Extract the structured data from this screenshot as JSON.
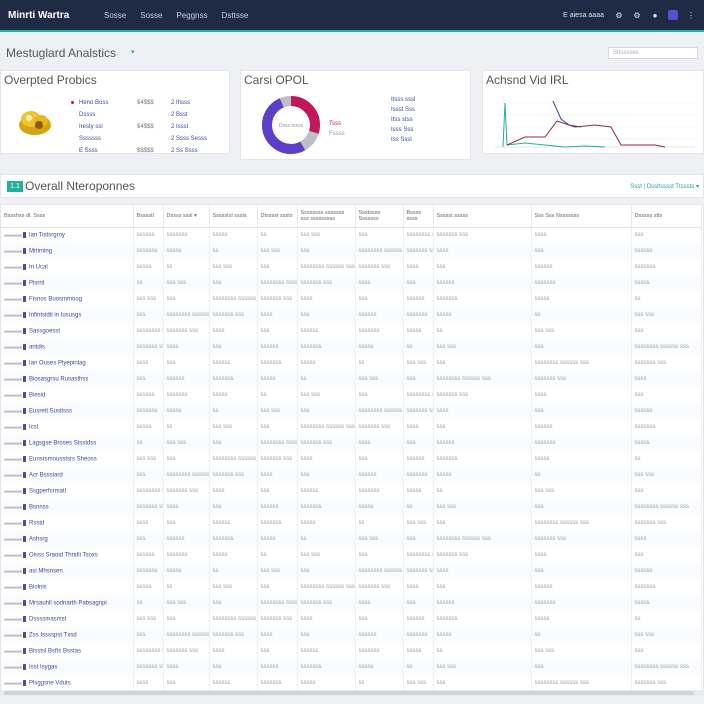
{
  "app": {
    "brand": "Minrti Wartra",
    "nav": [
      "Sosse",
      "Sosse",
      "Peggnss",
      "Dsttsse"
    ],
    "user": "E  aiesa aaaa"
  },
  "page": {
    "title": "Mestuglard Analstics",
    "search_placeholder": "Sttsssses"
  },
  "cards": {
    "products": {
      "title": "Overpted Probics",
      "col1": [
        "Heno Boss",
        "Dssss",
        "Iresty ssl",
        "Sssssss",
        "E Ssss"
      ],
      "col2": [
        "$4$$$",
        "",
        "$4$$$",
        "",
        "$$$$$"
      ],
      "col3": [
        "2 Ihsss",
        "2 Bsst",
        "2 Isssl",
        "2 Ssss Sesss",
        "2 Ss Ssss"
      ]
    },
    "cost": {
      "title": "Carsi OPOL",
      "center_label": "Dsss tnsss",
      "legend_a": [
        "Itsss sssl",
        "Issst Sss",
        "Itss stss",
        "Isss Sss",
        "Iss Sssl"
      ],
      "legend_b": [
        "",
        "",
        "",
        "Tsss",
        "Fssss"
      ],
      "colors": [
        "#c2185b",
        "#5b3fc7",
        "#bfbfc4"
      ]
    },
    "trend": {
      "title": "Achsnd Vid IRL"
    }
  },
  "section": {
    "badge": "1.1",
    "title": "Overall Nteroponnes",
    "links": "Ssst  |  Dssltsssst  Ttsssts  ▾"
  },
  "table": {
    "headers": [
      "Bssshss   dl. Ssss",
      "Bsssstl",
      "Dssss sssl ▾",
      "Ssssstsl sssts",
      "Dtsssst sssts",
      "Ssssssss sssssss sss sssssssss",
      "Ssstssss Sssssss",
      "Bssss ssss",
      "Ssssst sssss",
      "Sss Sss Nsssssss",
      "Dsssss stts",
      "Ssssssst sssssss"
    ],
    "rows": [
      "Ian Toitsrgroy",
      "Mrtiming",
      "Iri Ucal",
      "Pisrrit",
      "Fisnos Buosmmoog",
      "Infintsidti in Iususgs",
      "Sassgoesst",
      "antdis",
      "Ian Ouses Plyepinlag",
      "Biosasgrsu Rusasthss",
      "Biesid",
      "Eusrett Susitsss",
      "Icsl",
      "Lagsgse Broses Stsstdss",
      "Eunsrsmousstsrs Sheoss",
      "Acr Bsssiard",
      "Ssgperfsrmatl",
      "Bsnnss",
      "Rsstd",
      "Ashsrg",
      "Oisss Sraoid Thndli Tsoxs",
      "asi Mhsnsen",
      "Biolnis",
      "Mrsauhll sodnarth Pabsagnpi",
      "Dssssmasmst",
      "Zss Isssspst Txsd",
      "Bisstsl Bsfts Bsstas",
      "Isst Isygas",
      "Plsggsne Vduts"
    ],
    "cells": [
      "sss",
      "ssssss",
      "sssssss",
      "sssss",
      "ss",
      "sss sss",
      "sss",
      "ssssssss ssssss sss",
      "sssssss sss",
      "ssss"
    ]
  }
}
